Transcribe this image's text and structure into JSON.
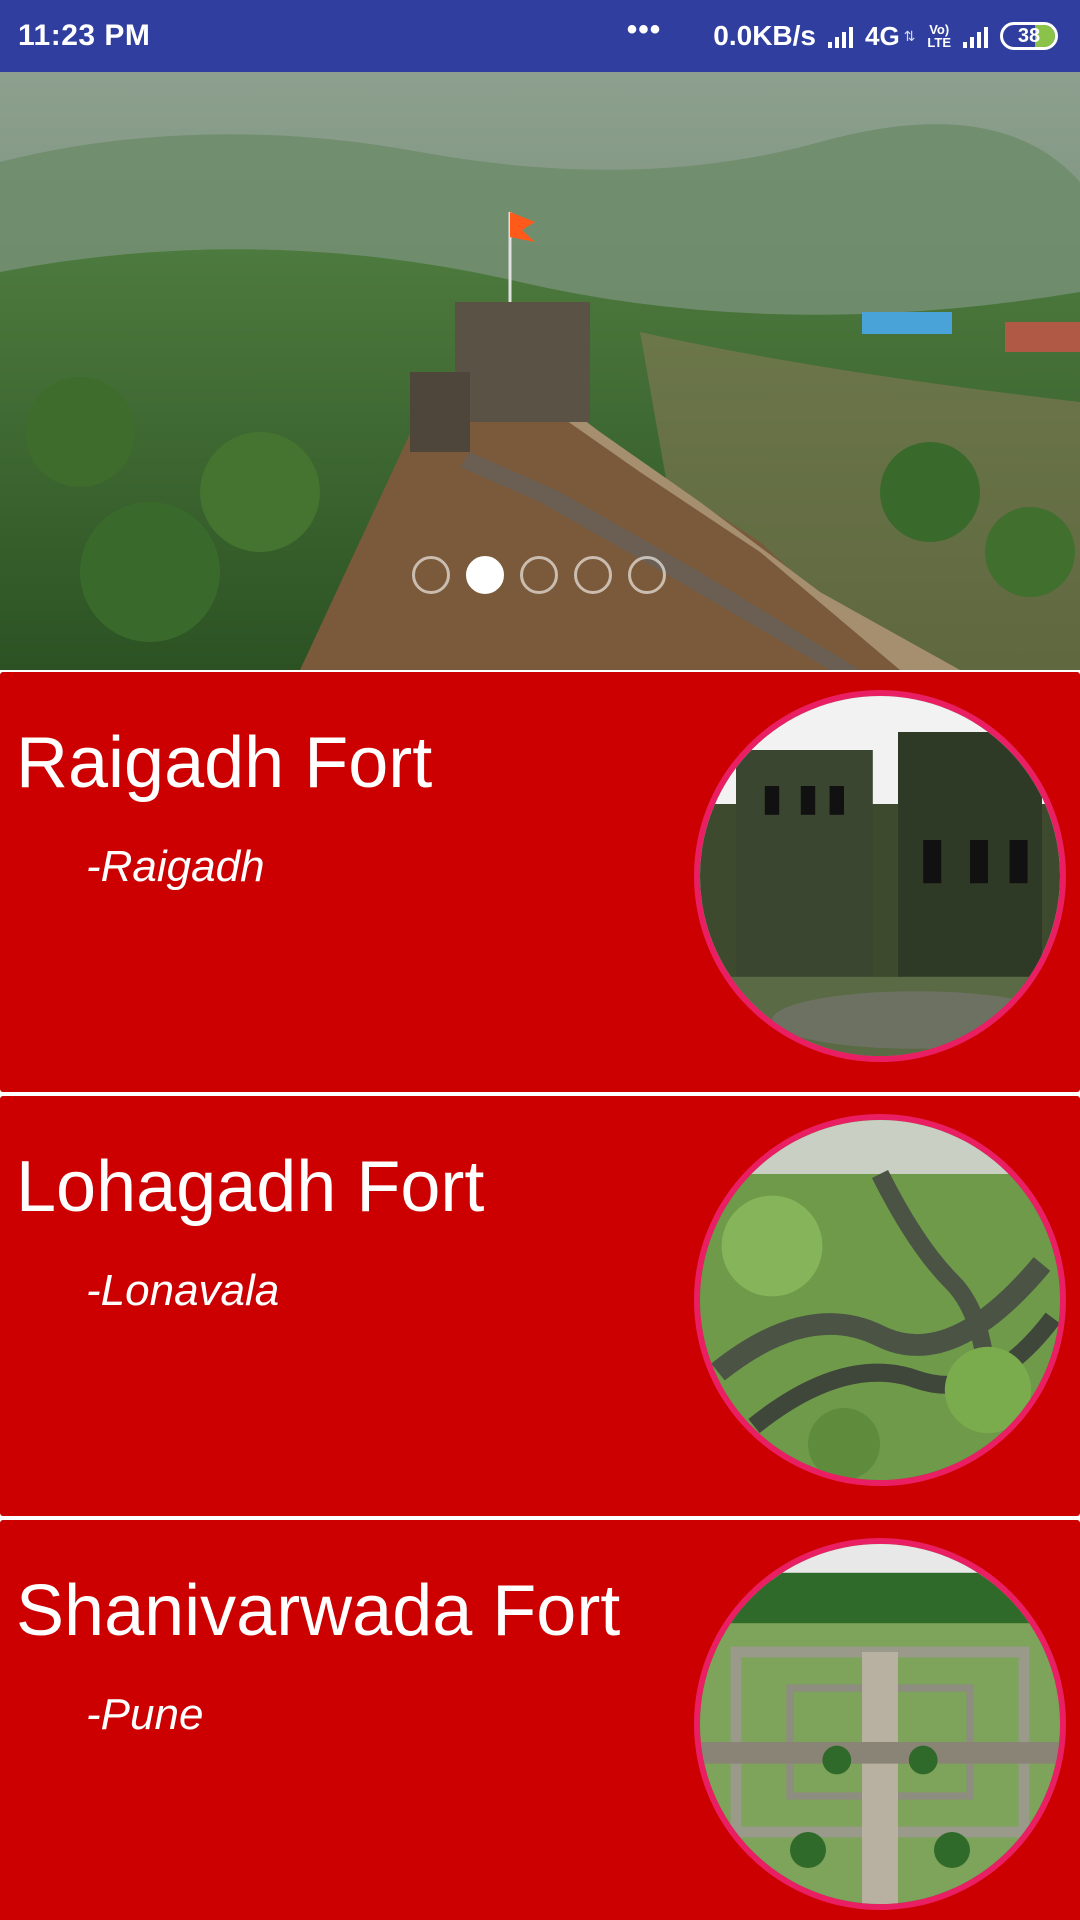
{
  "status_bar": {
    "time": "11:23 PM",
    "dots": "•••",
    "speed": "0.0KB/s",
    "network": "4G",
    "volte_top": "Vo)",
    "volte_bottom": "LTE",
    "battery": "38",
    "background": "#303f9f"
  },
  "hero": {
    "image": "mountain-fort-landscape",
    "pager": {
      "count": 5,
      "active_index": 1
    }
  },
  "forts": [
    {
      "title": "Raigadh Fort",
      "location": "-Raigadh",
      "image": "ruined-stone-towers"
    },
    {
      "title": "Lohagadh Fort",
      "location": "-Lonavala",
      "image": "green-fort-walls"
    },
    {
      "title": "Shanivarwada Fort",
      "location": "-Pune",
      "image": "palace-gardens"
    }
  ],
  "colors": {
    "card_background": "#cc0000",
    "photo_border": "#e91e63",
    "text": "#ffffff"
  }
}
